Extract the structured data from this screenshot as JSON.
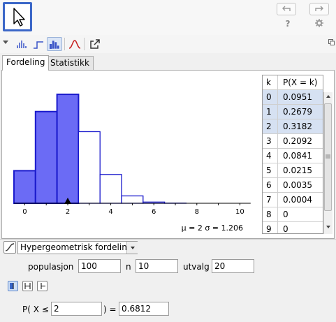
{
  "toolbar": {
    "move_tool": "move-tool",
    "undo_icon": "undo-icon",
    "redo_icon": "redo-icon",
    "help_label": "?",
    "settings_icon": "gear-icon"
  },
  "view_buttons": [
    "bar-graph-icon",
    "step-graph-icon",
    "histogram-icon",
    "normal-overlay-icon",
    "export-icon"
  ],
  "tabs": [
    {
      "label": "Fordeling",
      "active": true
    },
    {
      "label": "Statistikk",
      "active": false
    }
  ],
  "chart_data": {
    "type": "bar",
    "categories": [
      "0",
      "1",
      "2",
      "3",
      "4",
      "5",
      "6",
      "7",
      "8",
      "9",
      "10"
    ],
    "values": [
      0.0951,
      0.2679,
      0.3182,
      0.2092,
      0.0841,
      0.0215,
      0.0035,
      0.0004,
      0,
      0,
      0
    ],
    "highlighted": [
      0,
      1,
      2
    ],
    "tick_labels": [
      "0",
      "2",
      "4",
      "6",
      "8",
      "10"
    ],
    "xlim": [
      -0.5,
      10.5
    ],
    "mean_marker": 2,
    "highlight_color": "#6b6bf5",
    "stats_text": "μ = 2   σ = 1.206"
  },
  "table": {
    "headers": [
      "k",
      "P(X = k)"
    ],
    "rows": [
      {
        "k": "0",
        "p": "0.0951",
        "selected": true
      },
      {
        "k": "1",
        "p": "0.2679",
        "selected": true
      },
      {
        "k": "2",
        "p": "0.3182",
        "selected": true
      },
      {
        "k": "3",
        "p": "0.2092",
        "selected": false
      },
      {
        "k": "4",
        "p": "0.0841",
        "selected": false
      },
      {
        "k": "5",
        "p": "0.0215",
        "selected": false
      },
      {
        "k": "6",
        "p": "0.0035",
        "selected": false
      },
      {
        "k": "7",
        "p": "0.0004",
        "selected": false
      },
      {
        "k": "8",
        "p": "0",
        "selected": false
      },
      {
        "k": "9",
        "p": "0",
        "selected": false
      }
    ]
  },
  "distribution": {
    "selected": "Hypergeometrisk fordeling",
    "params": [
      {
        "label": "populasjon",
        "value": "100"
      },
      {
        "label": "n",
        "value": "10"
      },
      {
        "label": "utvalg",
        "value": "20"
      }
    ]
  },
  "probability": {
    "prefix": "P( X ≤",
    "bound_value": "2",
    "suffix": ") =",
    "result": "0.6812"
  }
}
